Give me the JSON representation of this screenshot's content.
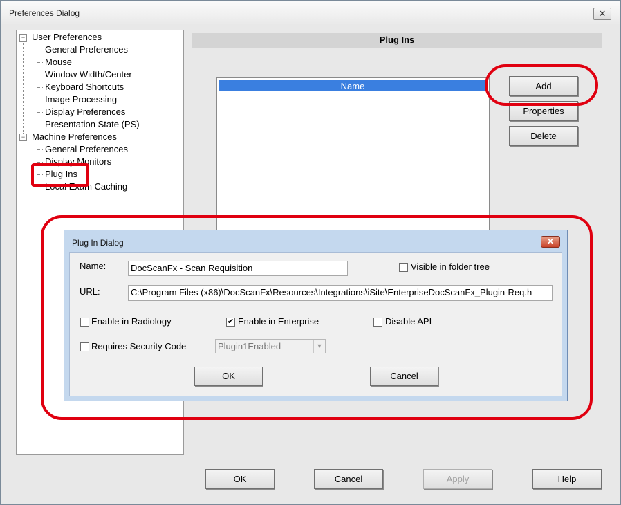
{
  "window": {
    "title": "Preferences Dialog",
    "close_glyph": "✕"
  },
  "tree": {
    "expander_glyph": "−",
    "nodes": [
      {
        "label": "User Preferences"
      },
      {
        "label": "General Preferences"
      },
      {
        "label": "Mouse"
      },
      {
        "label": "Window Width/Center"
      },
      {
        "label": "Keyboard Shortcuts"
      },
      {
        "label": "Image Processing"
      },
      {
        "label": "Display Preferences"
      },
      {
        "label": "Presentation State (PS)"
      },
      {
        "label": "Machine Preferences"
      },
      {
        "label": "General Preferences"
      },
      {
        "label": "Display Monitors"
      },
      {
        "label": "Plug Ins"
      },
      {
        "label": "Local Exam Caching"
      }
    ]
  },
  "panel": {
    "title": "Plug Ins",
    "list_header": "Name",
    "add_label": "Add",
    "properties_label": "Properties",
    "delete_label": "Delete"
  },
  "footer": {
    "ok_label": "OK",
    "cancel_label": "Cancel",
    "apply_label": "Apply",
    "help_label": "Help"
  },
  "plugin_dialog": {
    "title": "Plug In Dialog",
    "close_glyph": "✕",
    "name_label": "Name:",
    "name_value": "DocScanFx - Scan Requisition",
    "url_label": "URL:",
    "url_value": "C:\\Program Files (x86)\\DocScanFx\\Resources\\Integrations\\iSite\\EnterpriseDocScanFx_Plugin-Req.h",
    "visible_in_folder_tree": {
      "label": "Visible in folder tree",
      "checked": false
    },
    "enable_in_radiology": {
      "label": "Enable in Radiology",
      "checked": false
    },
    "enable_in_enterprise": {
      "label": "Enable in Enterprise",
      "checked": true,
      "mark": "✔"
    },
    "disable_api": {
      "label": "Disable API",
      "checked": false
    },
    "requires_security_code": {
      "label": "Requires Security Code",
      "checked": false
    },
    "security_code_select": "Plugin1Enabled",
    "select_arrow": "▼",
    "ok_label": "OK",
    "cancel_label": "Cancel"
  },
  "colors": {
    "highlight": "#e00010",
    "list_header_bg": "#3a7fe0"
  }
}
